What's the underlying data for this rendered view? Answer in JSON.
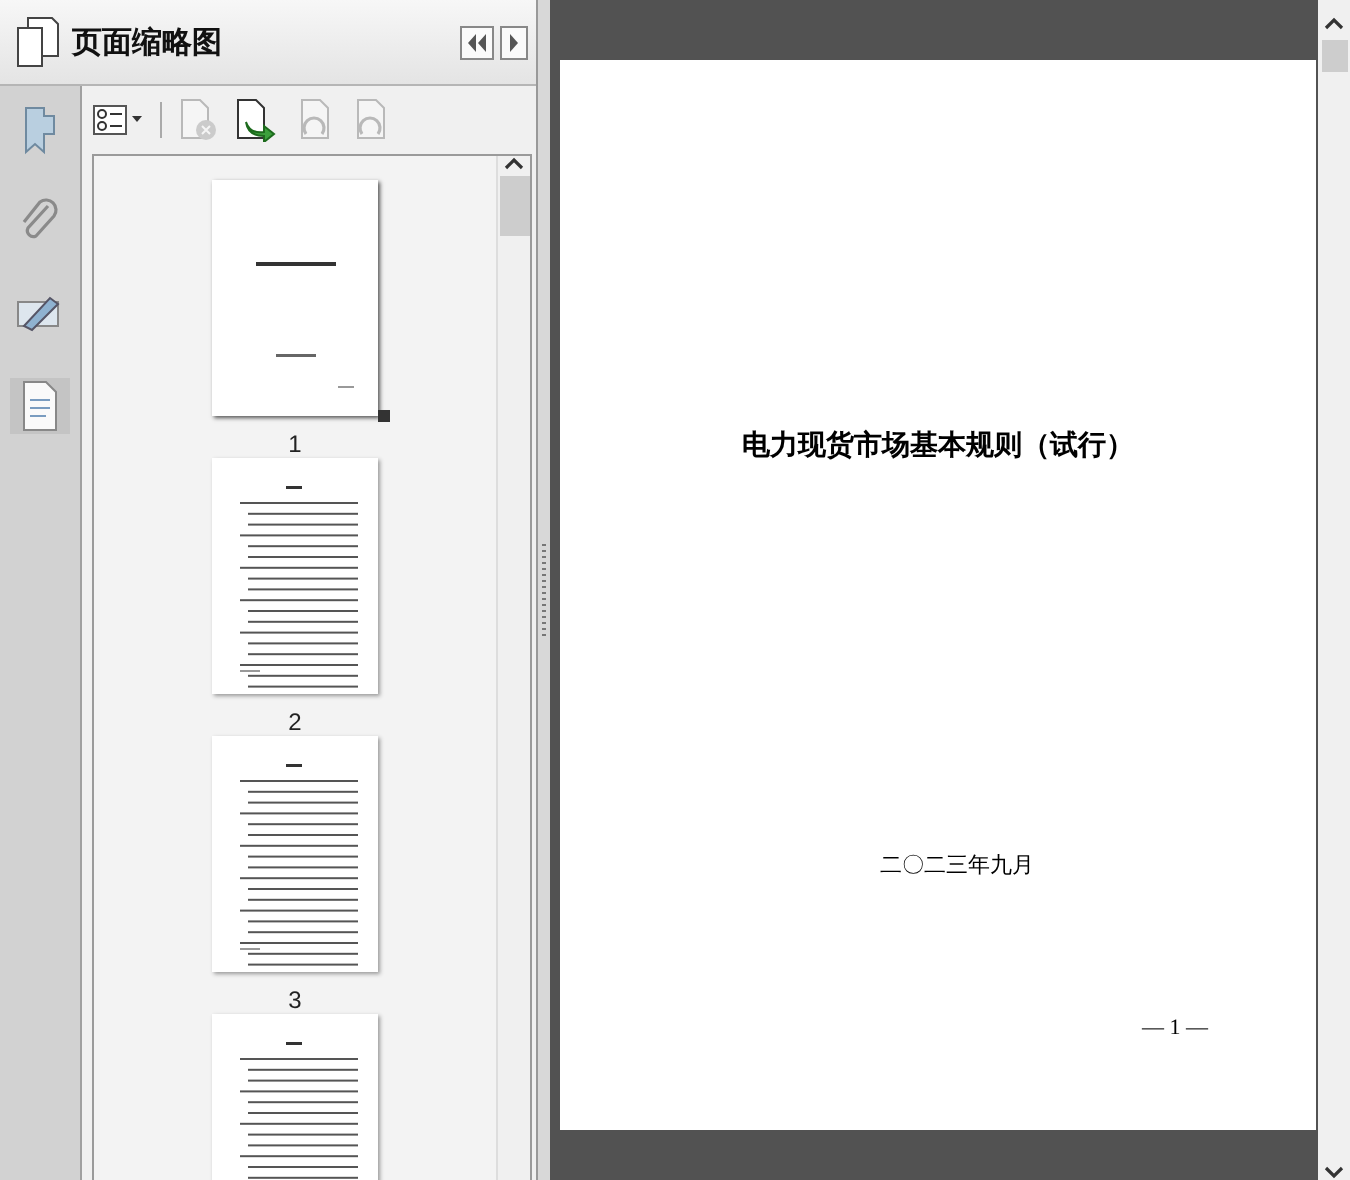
{
  "panel": {
    "title": "页面缩略图"
  },
  "rail": [
    {
      "kind": "bookmark",
      "selected": false
    },
    {
      "kind": "attachment",
      "selected": false
    },
    {
      "kind": "signature",
      "selected": false
    },
    {
      "kind": "pages",
      "selected": true
    }
  ],
  "toolbar": [
    {
      "kind": "options",
      "disabled": false
    },
    {
      "kind": "delete",
      "disabled": true
    },
    {
      "kind": "insert",
      "disabled": false
    },
    {
      "kind": "undo",
      "disabled": true
    },
    {
      "kind": "redo",
      "disabled": true
    }
  ],
  "thumbnails": [
    {
      "label": "1",
      "kind": "cover",
      "selected": true
    },
    {
      "label": "2",
      "kind": "toc",
      "selected": false
    },
    {
      "label": "3",
      "kind": "toc",
      "selected": false
    },
    {
      "kind": "toc",
      "selected": false
    }
  ],
  "document": {
    "title": "电力现货市场基本规则（试行）",
    "date": "二〇二三年九月",
    "page_number": "— 1 —"
  }
}
